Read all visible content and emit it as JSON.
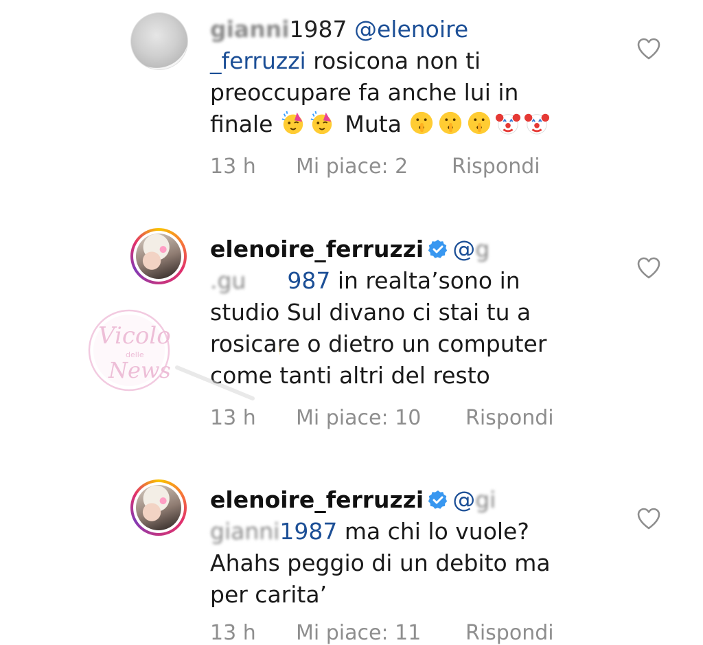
{
  "comments": [
    {
      "username": "gianni987",
      "username_visible": "gianni",
      "username_tail": "1987",
      "mention": "@elenoire",
      "mention_cont": "_ferruzzi",
      "text_line1_after": "rosicona non ti",
      "text_line2": "preoccupare fa anche lui in",
      "text_line3_start": "finale",
      "text_line3_mid": "Muta",
      "emojis_party": [
        "partying-face-emoji",
        "partying-face-emoji"
      ],
      "emojis_shush": [
        "shushing-face-emoji",
        "shushing-face-emoji",
        "shushing-face-emoji"
      ],
      "emojis_clown": [
        "clown-face-emoji",
        "clown-face-emoji"
      ],
      "time": "13 h",
      "likes": "Mi piace: 2",
      "reply": "Rispondi"
    },
    {
      "username": "elenoire_ferruzzi",
      "verified": true,
      "mention_start": "@",
      "mention_blurred_1": "g",
      "mention_blurred_2": ".gu",
      "mention_tail": "987",
      "text_line1_after": "in realta’sono in",
      "text_line2": "studio Sul divano ci stai tu a",
      "text_line3": "rosicare o dietro un computer",
      "text_line4": "come tanti altri del resto",
      "time": "13 h",
      "likes": "Mi piace: 10",
      "reply": "Rispondi"
    },
    {
      "username": "elenoire_ferruzzi",
      "verified": true,
      "mention_start": "@",
      "mention_blurred_1": "gi",
      "mention_blurred_2": "gianni",
      "mention_tail": "1987",
      "text_line1_after": "ma chi lo vuole?",
      "text_line2": "Ahahs peggio di un debito ma",
      "text_line3": "per carita’",
      "time": "13 h",
      "likes": "Mi piace: 11",
      "reply": "Rispondi"
    }
  ],
  "watermark": {
    "line1": "Vicolo",
    "line2": "delle",
    "line3": "News"
  },
  "colors": {
    "mention": "#1c4f96",
    "meta": "#8e8e8e",
    "verified": "#3897f0",
    "watermark": "#e8a0c8"
  }
}
